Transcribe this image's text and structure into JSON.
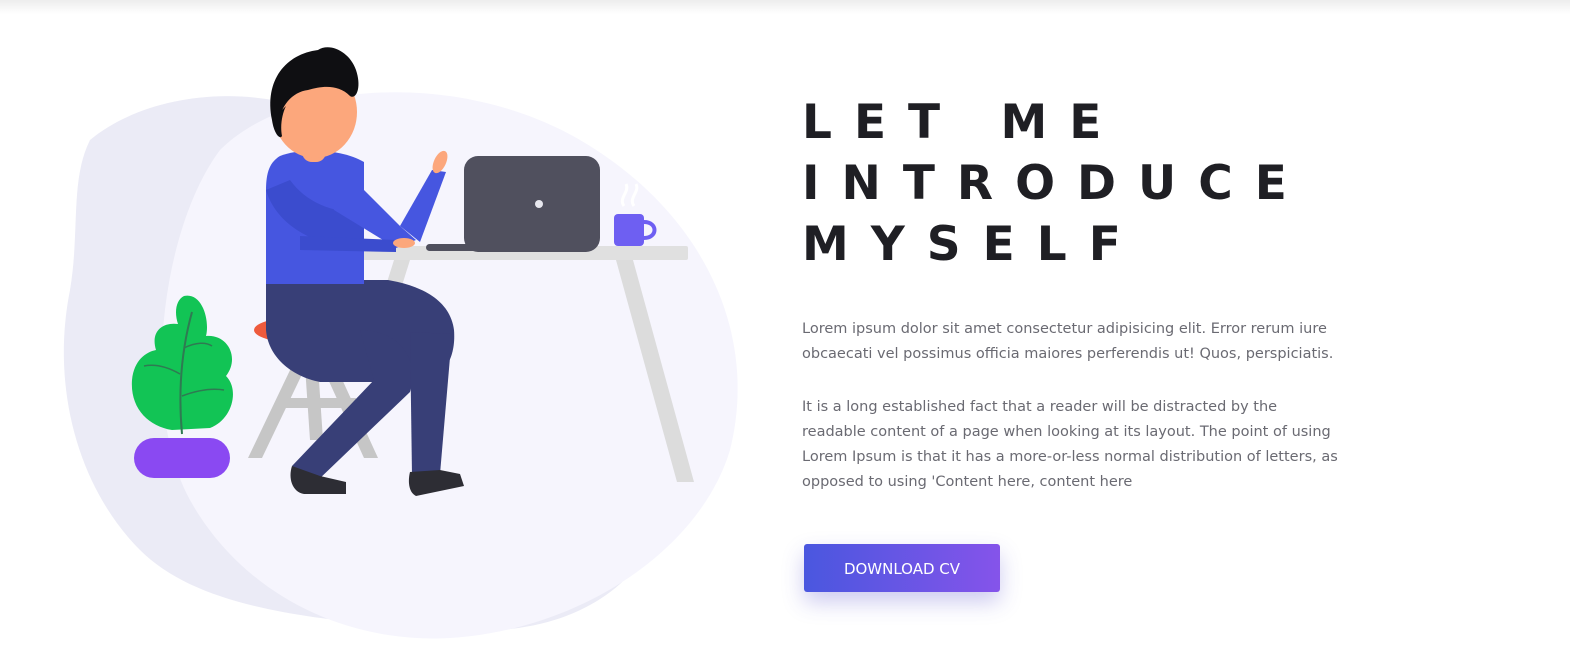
{
  "intro": {
    "heading_lines": [
      "LET ME",
      "INTRODUCE",
      "MYSELF"
    ],
    "paragraph_1": "Lorem ipsum dolor sit amet consectetur adipisicing elit. Error rerum iure obcaecati vel possimus officia maiores perferendis ut! Quos, perspiciatis.",
    "paragraph_2": "It is a long established fact that a reader will be distracted by the readable content of a page when looking at its layout. The point of using Lorem Ipsum is that it has a more-or-less normal distribution of letters, as opposed to using 'Content here, content here",
    "button_label": "DOWNLOAD CV"
  },
  "colors": {
    "heading": "#1f1f24",
    "body_text": "#6a6a72",
    "button_gradient_start": "#4a57df",
    "button_gradient_end": "#8554ea",
    "blob_background": "#f4f3fc",
    "shirt": "#4656e0",
    "pants": "#383f77",
    "plant_leaf": "#12c455",
    "plant_pot": "#8a49f2",
    "stool_seat": "#ee5a3c",
    "laptop": "#50505e",
    "mug": "#6e5ff2"
  },
  "illustration": {
    "icon": "person-working-at-laptop-illustration"
  }
}
